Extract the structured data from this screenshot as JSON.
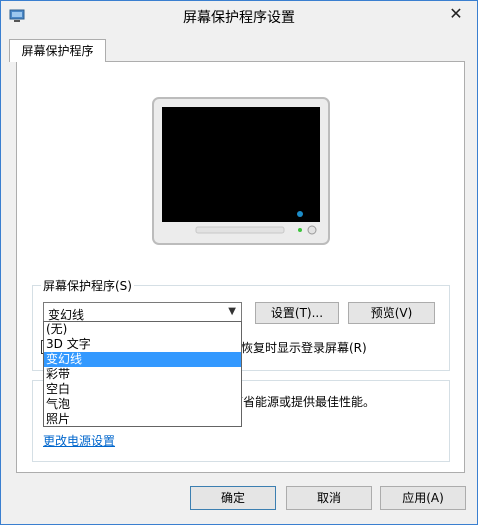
{
  "window": {
    "title": "屏幕保护程序设置",
    "close_label": "✕"
  },
  "tabs": [
    {
      "label": "屏幕保护程序"
    }
  ],
  "screensaver_group": {
    "label": "屏幕保护程序(S)",
    "selected": "变幻线",
    "settings_button": "设置(T)...",
    "preview_button": "预览(V)",
    "resume_checkbox_label": "恢复时显示登录屏幕(R)",
    "resume_checked": false
  },
  "dropdown": {
    "options": [
      "(无)",
      "3D 文字",
      "变幻线",
      "彩带",
      "空白",
      "气泡",
      "照片"
    ],
    "selected_index": 2
  },
  "power_group": {
    "description_visible": "节省能源或提供最佳性能。",
    "link": "更改电源设置"
  },
  "footer": {
    "ok": "确定",
    "cancel": "取消",
    "apply": "应用(A)"
  }
}
